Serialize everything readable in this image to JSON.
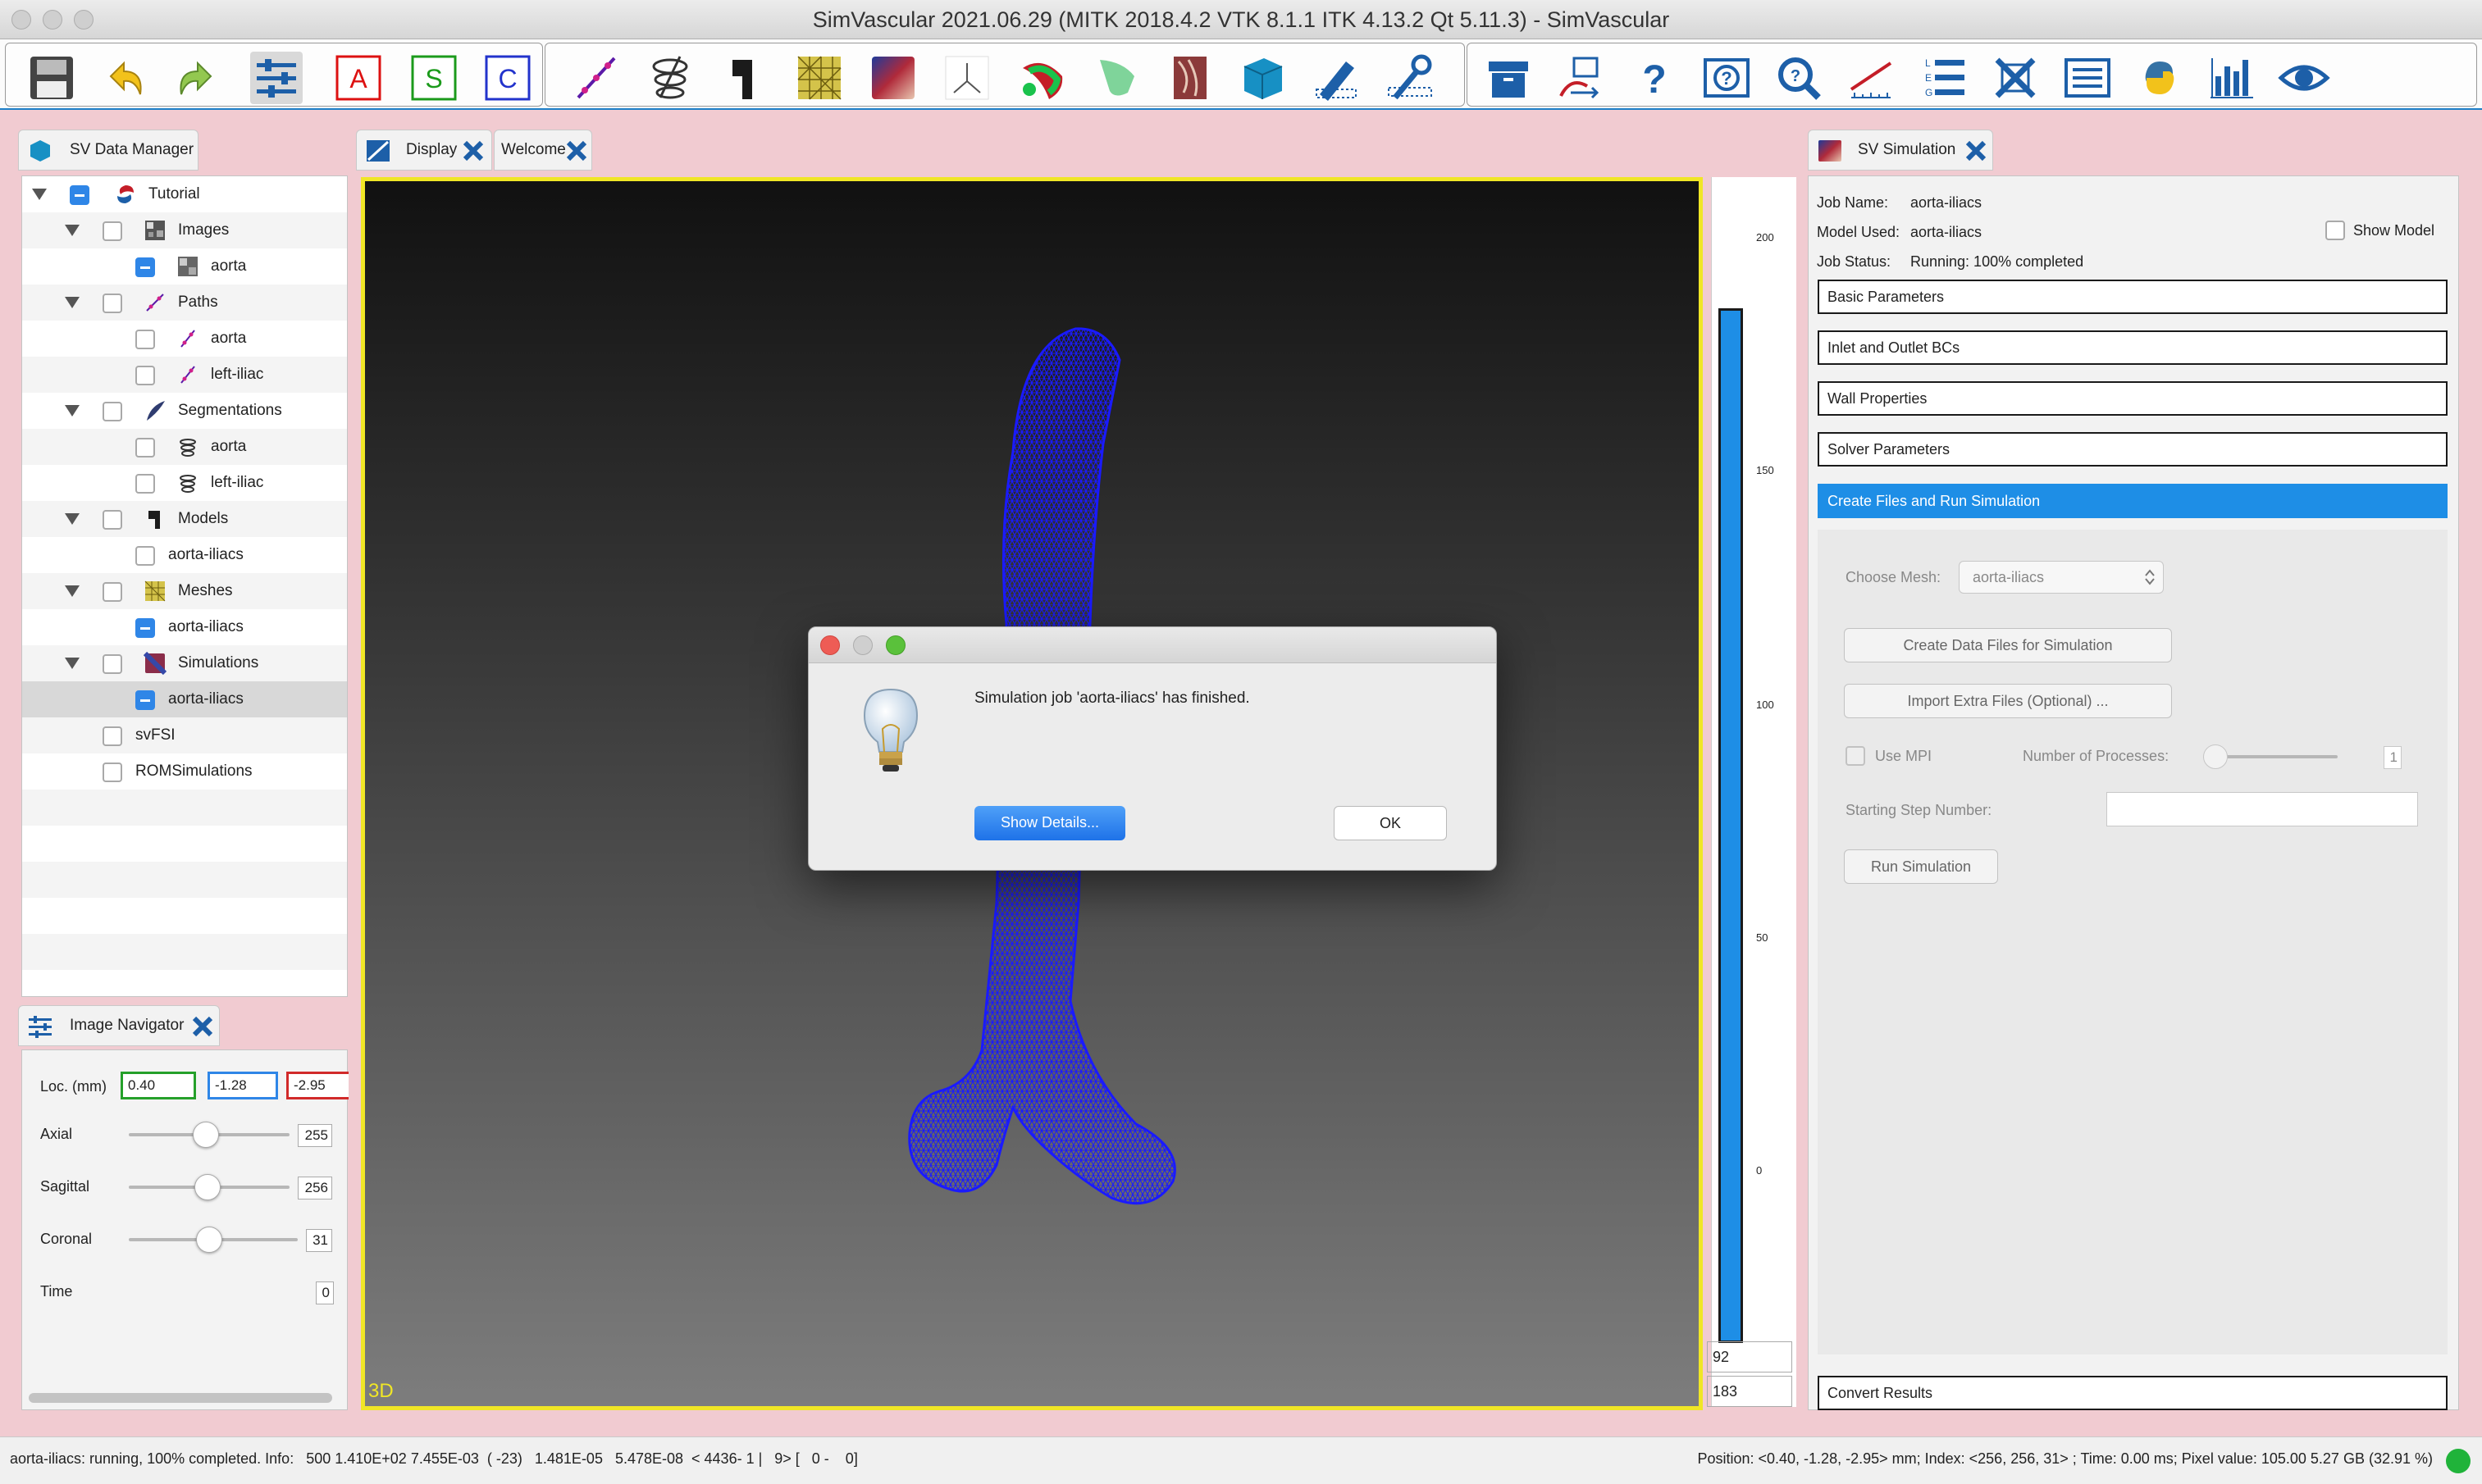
{
  "window": {
    "title": "SimVascular 2021.06.29 (MITK 2018.4.2 VTK 8.1.1 ITK 4.13.2 Qt 5.11.3) - SimVascular"
  },
  "toolbar": {
    "groups": [
      {
        "buttons": [
          "save-icon",
          "undo-icon",
          "redo-icon",
          "image-navigator-icon",
          "axial-view-icon",
          "sagittal-view-icon",
          "coronal-view-icon"
        ]
      },
      {
        "buttons": [
          "path-planning-icon",
          "segmentation-icon",
          "modeling-icon",
          "meshing-icon",
          "simulation-icon",
          "point-set-icon",
          "probe-icon",
          "svfsi-icon",
          "image-processing-icon",
          "cube-icon",
          "ruler-icon",
          "tools-icon"
        ]
      },
      {
        "buttons": [
          "archive-icon",
          "image-swap-icon",
          "help-icon",
          "info-icon",
          "search-icon",
          "measure-icon",
          "legend-icon",
          "view-config-icon",
          "list-icon",
          "python-icon",
          "histogram-icon",
          "visibility-icon"
        ]
      }
    ],
    "letters": {
      "axial": "A",
      "sagittal": "S",
      "coronal": "C"
    }
  },
  "data_manager": {
    "tab_label": "SV Data Manager",
    "tree": [
      {
        "label": "Tutorial",
        "level": 0,
        "expanded": true,
        "checked": "partial",
        "icon": "project-icon"
      },
      {
        "label": "Images",
        "level": 1,
        "expanded": true,
        "checked": "none",
        "icon": "images-icon"
      },
      {
        "label": "aorta",
        "level": 2,
        "checked": "partial",
        "icon": "image-icon"
      },
      {
        "label": "Paths",
        "level": 1,
        "expanded": true,
        "checked": "none",
        "icon": "paths-icon"
      },
      {
        "label": "aorta",
        "level": 2,
        "checked": "none",
        "icon": "path-icon"
      },
      {
        "label": "left-iliac",
        "level": 2,
        "checked": "none",
        "icon": "path-icon"
      },
      {
        "label": "Segmentations",
        "level": 1,
        "expanded": true,
        "checked": "none",
        "icon": "segmentations-icon"
      },
      {
        "label": "aorta",
        "level": 2,
        "checked": "none",
        "icon": "segmentation-icon"
      },
      {
        "label": "left-iliac",
        "level": 2,
        "checked": "none",
        "icon": "segmentation-icon"
      },
      {
        "label": "Models",
        "level": 1,
        "expanded": true,
        "checked": "none",
        "icon": "models-icon"
      },
      {
        "label": "aorta-iliacs",
        "level": 2,
        "checked": "none",
        "icon": ""
      },
      {
        "label": "Meshes",
        "level": 1,
        "expanded": true,
        "checked": "none",
        "icon": "meshes-icon"
      },
      {
        "label": "aorta-iliacs",
        "level": 2,
        "checked": "partial",
        "icon": ""
      },
      {
        "label": "Simulations",
        "level": 1,
        "expanded": true,
        "checked": "none",
        "icon": "simulations-icon"
      },
      {
        "label": "aorta-iliacs",
        "level": 2,
        "checked": "partial",
        "icon": "",
        "selected": true
      },
      {
        "label": "svFSI",
        "level": 1,
        "checked": "none",
        "icon": ""
      },
      {
        "label": "ROMSimulations",
        "level": 1,
        "checked": "none",
        "icon": ""
      }
    ]
  },
  "image_navigator": {
    "tab_label": "Image Navigator",
    "loc_label": "Loc. (mm)",
    "loc_x": "0.40",
    "loc_y": "-1.28",
    "loc_z": "-2.95",
    "axial_label": "Axial",
    "axial_value": "255",
    "sagittal_label": "Sagittal",
    "sagittal_value": "256",
    "coronal_label": "Coronal",
    "coronal_value": "31",
    "time_label": "Time",
    "time_value": "0"
  },
  "center_tabs": {
    "display": "Display",
    "welcome": "Welcome"
  },
  "viewer": {
    "label": "3D",
    "ruler_ticks": [
      "200",
      "150",
      "100",
      "50",
      "0"
    ],
    "ruler_value_top": "92",
    "ruler_value_bottom": "183",
    "colors": {
      "mesh": "#1a1aff",
      "frame": "#f0e626"
    }
  },
  "simulation": {
    "tab_label": "SV Simulation",
    "job_name_label": "Job Name:",
    "job_name": "aorta-iliacs",
    "model_used_label": "Model Used:",
    "model_used": "aorta-iliacs",
    "job_status_label": "Job Status:",
    "job_status": "Running: 100% completed",
    "show_model_label": "Show Model",
    "sections": [
      "Basic Parameters",
      "Inlet and Outlet BCs",
      "Wall Properties",
      "Solver Parameters",
      "Create Files and Run Simulation"
    ],
    "choose_mesh_label": "Choose Mesh:",
    "choose_mesh_value": "aorta-iliacs",
    "create_data_files": "Create Data Files for Simulation",
    "import_extra_files": "Import Extra Files (Optional) ...",
    "use_mpi_label": "Use MPI",
    "num_processes_label": "Number of Processes:",
    "num_processes": "1",
    "starting_step_label": "Starting Step Number:",
    "run_simulation": "Run Simulation",
    "convert_results": "Convert Results",
    "colors": {
      "active_section": "#1e8ee6"
    }
  },
  "dialog": {
    "message": "Simulation job 'aorta-iliacs' has finished.",
    "show_details": "Show Details...",
    "ok": "OK",
    "icon": "lightbulb-icon"
  },
  "status": {
    "left": "aorta-iliacs: running, 100% completed. Info:   500 1.410E+02 7.455E-03  ( -23)   1.481E-05   5.478E-08  < 4436- 1 |   9> [   0 -    0]",
    "right": "Position: <0.40, -1.28, -2.95> mm; Index: <256, 256, 31> ; Time: 0.00 ms; Pixel value: 105.00   5.27 GB (32.91 %)"
  }
}
